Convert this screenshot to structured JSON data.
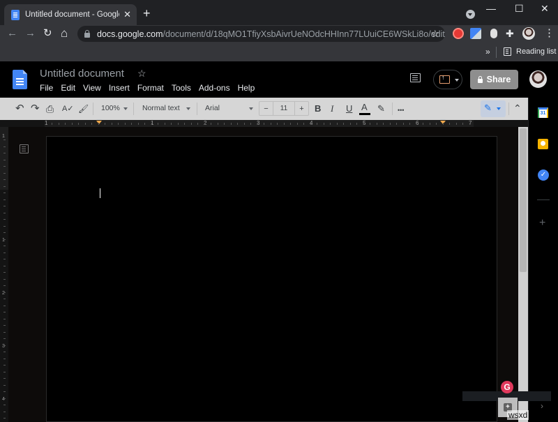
{
  "browser": {
    "tab": {
      "title": "Untitled document - Google Docs",
      "favicon": "google-docs-icon"
    },
    "new_tab_label": "+",
    "window_controls": {
      "minimize": "—",
      "maximize": "☐",
      "close": "✕"
    },
    "nav": {
      "back": "←",
      "forward": "→",
      "reload": "↻",
      "home": "⌂"
    },
    "address": {
      "host": "docs.google.com",
      "path": "/document/d/18qMO1TfiyXsbAivrUeNOdcHHInn77LUuiCE6WSkLi8o/edit"
    },
    "bookmark_star": "☆",
    "extensions": [
      "screen-recorder-icon",
      "google-translate-icon",
      "mouse-extension-icon",
      "puzzle-extensions-icon",
      "profile-avatar"
    ],
    "menu_icon": "⋮",
    "bookmarks_bar": {
      "overflow": "»",
      "reading_list": "Reading list"
    }
  },
  "docs": {
    "title": "Untitled document",
    "star": "☆",
    "menu": [
      "File",
      "Edit",
      "View",
      "Insert",
      "Format",
      "Tools",
      "Add-ons",
      "Help"
    ],
    "share_label": "Share",
    "toolbar": {
      "undo": "↶",
      "redo": "↷",
      "print": "⎙",
      "spellcheck": "A✓",
      "paint_format": "🖌",
      "zoom": "100%",
      "style": "Normal text",
      "font": "Arial",
      "font_size": "11",
      "minus": "−",
      "plus": "+",
      "bold": "B",
      "italic": "I",
      "underline": "U",
      "text_color": "A",
      "text_color_value": "#000000",
      "highlight": "✎",
      "more": "•••",
      "edit_mode": "✎",
      "collapse": "⌃"
    },
    "ruler": {
      "horizontal_labels": [
        "1",
        "1",
        "2",
        "3",
        "4",
        "5",
        "6",
        "7"
      ],
      "vertical_labels": [
        "1",
        "1",
        "2",
        "3",
        "4"
      ]
    },
    "side_panel": {
      "calendar_label": "31",
      "add": "+",
      "chevron": "›"
    },
    "grammarly_label": "G",
    "explore_icon": "✦",
    "watermark": "wsxd"
  },
  "colors": {
    "docs_blue": "#4285f4",
    "share_bg": "#8e8e8e",
    "present_accent": "#e8a071",
    "indent_marker": "#f0a84b",
    "grammarly": "#e0395c"
  }
}
